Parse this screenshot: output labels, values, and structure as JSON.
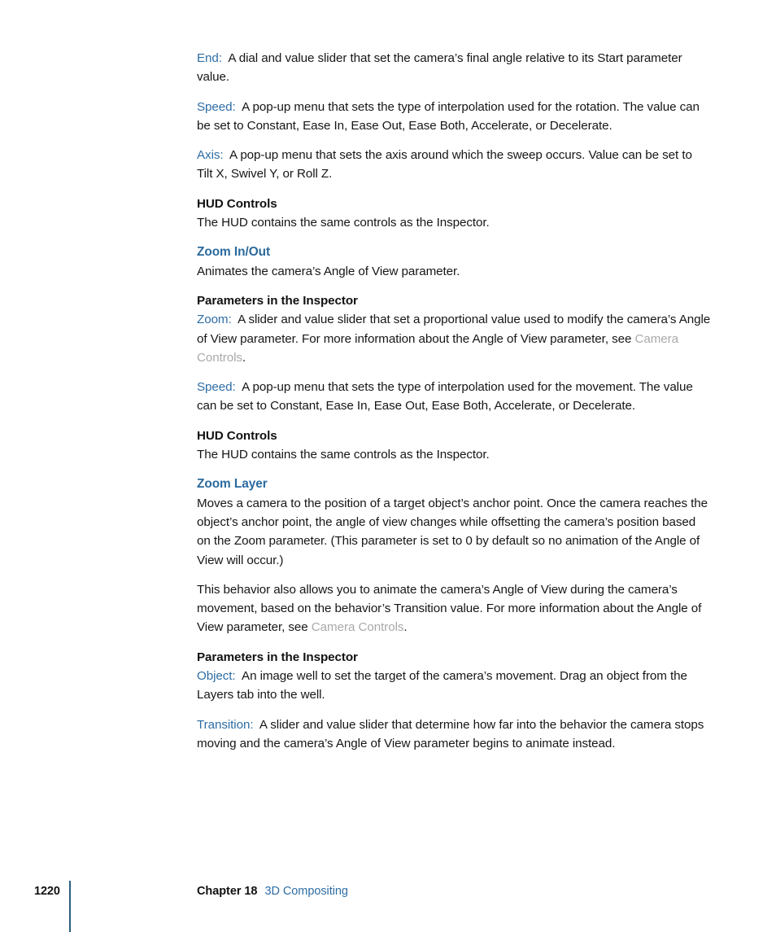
{
  "page": {
    "background": "#ffffff",
    "accent_blue": "#2e6da4",
    "heading_blue": "#2a6a9e",
    "xref_gray": "#a9a9a9",
    "rule_blue": "#2a5d80"
  },
  "body": {
    "blocks": [
      {
        "id": "end-param",
        "term": "End:",
        "text": "A dial and value slider that set the camera’s final angle relative to its Start parameter value."
      },
      {
        "id": "speed-param-1",
        "term": "Speed:",
        "text": "A pop-up menu that sets the type of interpolation used for the rotation. The value can be set to Constant, Ease In, Ease Out, Ease Both, Accelerate, or Decelerate."
      },
      {
        "id": "axis-param",
        "term": "Axis:",
        "text": "A pop-up menu that sets the axis around which the sweep occurs. Value can be set to Tilt X, Swivel Y, or Roll Z."
      }
    ],
    "hud_controls_1": {
      "heading": "HUD Controls",
      "text": "The HUD contains the same controls as the Inspector."
    },
    "zoom_in_out": {
      "heading": "Zoom In/Out",
      "intro": "Animates the camera’s Angle of View parameter.",
      "params_heading": "Parameters in the Inspector",
      "zoom_term": "Zoom:",
      "zoom_text_before": "A slider and value slider that set a proportional value used to modify the camera’s Angle of View parameter. For more information about the Angle of View parameter, see ",
      "zoom_xref": "Camera Controls",
      "zoom_text_after": ".",
      "speed_term": "Speed:",
      "speed_text": "A pop-up menu that sets the type of interpolation used for the movement. The value can be set to Constant, Ease In, Ease Out, Ease Both, Accelerate, or Decelerate."
    },
    "hud_controls_2": {
      "heading": "HUD Controls",
      "text": "The HUD contains the same controls as the Inspector."
    },
    "zoom_layer": {
      "heading": "Zoom Layer",
      "intro": "Moves a camera to the position of a target object’s anchor point. Once the camera reaches the object’s anchor point, the angle of view changes while offsetting the camera’s position based on the Zoom parameter. (This parameter is set to 0 by default so no animation of the Angle of View will occur.)",
      "detail_before": "This behavior also allows you to animate the camera’s Angle of View during the camera’s movement, based on the behavior’s Transition value. For more information about the Angle of View parameter, see ",
      "detail_xref": "Camera Controls",
      "detail_after": ".",
      "params_heading": "Parameters in the Inspector",
      "object_term": "Object:",
      "object_text": "An image well to set the target of the camera’s movement. Drag an object from the Layers tab into the well.",
      "transition_term": "Transition:",
      "transition_text": "A slider and value slider that determine how far into the behavior the camera stops moving and the camera’s Angle of View parameter begins to animate instead."
    }
  },
  "footer": {
    "page_number": "1220",
    "chapter_label": "Chapter 18",
    "chapter_title": "3D Compositing"
  }
}
